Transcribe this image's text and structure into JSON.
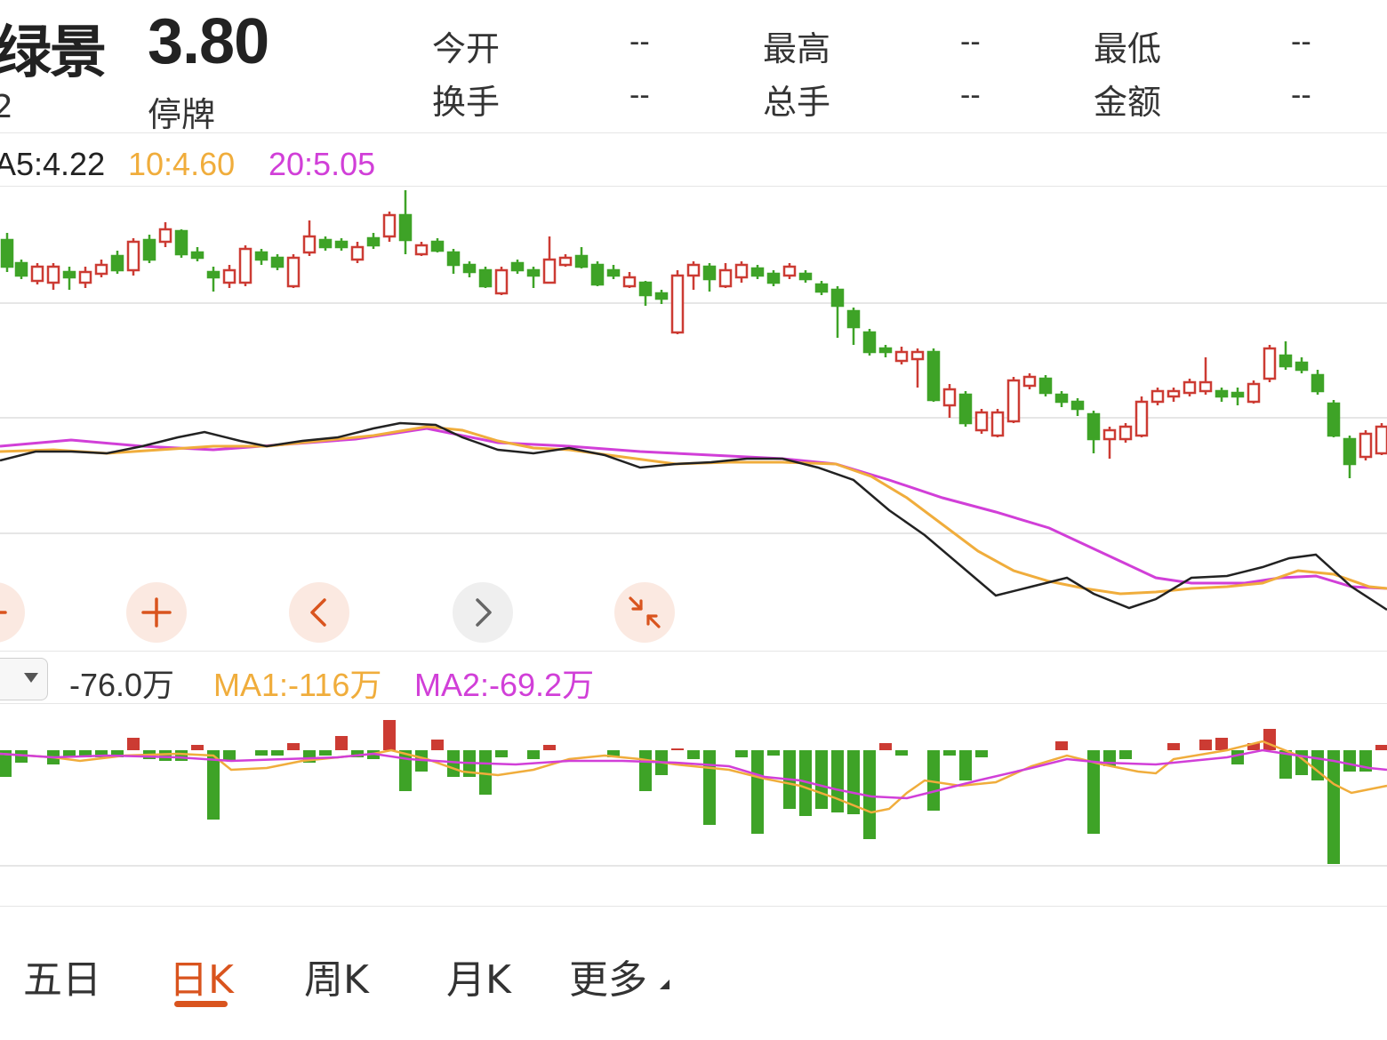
{
  "header": {
    "name": "绿景",
    "code": "2",
    "price": "3.80",
    "status": "停牌",
    "stats": [
      {
        "label": "今开",
        "value": "--"
      },
      {
        "label": "最高",
        "value": "--"
      },
      {
        "label": "最低",
        "value": "--"
      },
      {
        "label": "换手",
        "value": "--"
      },
      {
        "label": "总手",
        "value": "--"
      },
      {
        "label": "金额",
        "value": "--"
      }
    ]
  },
  "ma_legend": {
    "ma5": "A5:4.22",
    "ma10": "10:4.60",
    "ma20": "20:5.05"
  },
  "controls": [
    {
      "icon": "minus-icon"
    },
    {
      "icon": "plus-icon"
    },
    {
      "icon": "chevron-left-icon"
    },
    {
      "icon": "chevron-right-icon"
    },
    {
      "icon": "compress-icon"
    }
  ],
  "indicator": {
    "value": "-76.0万",
    "ma1": "MA1:-116万",
    "ma2": "MA2:-69.2万"
  },
  "tabs": [
    {
      "label": "五日",
      "active": false
    },
    {
      "label": "日K",
      "active": true
    },
    {
      "label": "周K",
      "active": false
    },
    {
      "label": "月K",
      "active": false
    },
    {
      "label": "更多",
      "active": false
    }
  ],
  "colors": {
    "up": "#cc3b33",
    "down": "#3ea327",
    "ma5": "#222222",
    "ma10": "#f0ad3c",
    "ma20": "#d13fd8",
    "accent": "#d9541e"
  }
}
